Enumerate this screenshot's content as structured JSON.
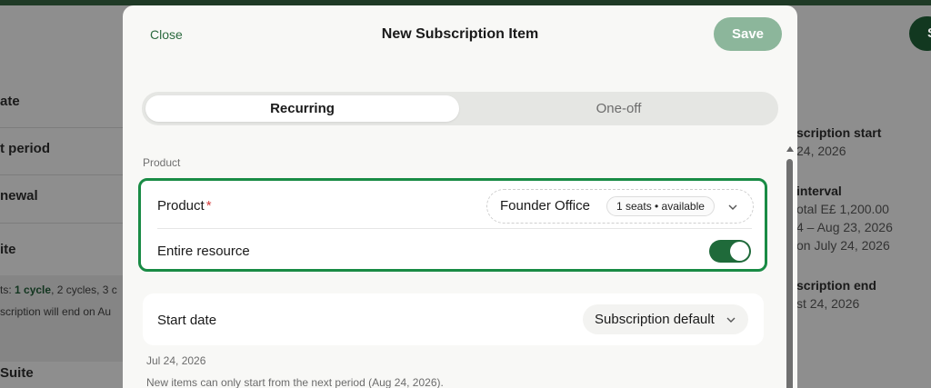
{
  "background": {
    "left_rows": [
      "ate",
      "t period",
      "newal",
      "ite"
    ],
    "left_cycles_prefix": "ts: ",
    "left_cycles_bold1": "1 cycle",
    "left_cycles_mid": ", 2 cycles, 3 c",
    "left_note": "scription will end on Au",
    "left_bottom": "Suite",
    "right_start_title": "scription start",
    "right_start_value": "24, 2026",
    "right_interval_title": "interval",
    "right_interval_line1": "otal E£ 1,200.00",
    "right_interval_line2": "4 – Aug 23, 2026",
    "right_interval_line3": "on July 24, 2026",
    "right_end_title": "scription end",
    "right_end_value": "st 24, 2026",
    "corner_button": "S"
  },
  "modal": {
    "close_label": "Close",
    "title": "New Subscription Item",
    "save_label": "Save",
    "tabs": [
      {
        "label": "Recurring",
        "active": true
      },
      {
        "label": "One-off",
        "active": false
      }
    ],
    "section_label": "Product",
    "product": {
      "label": "Product",
      "required_mark": "*",
      "selected_name": "Founder Office",
      "availability": "1 seats • available",
      "icon": "chevron-down-icon"
    },
    "entire_resource": {
      "label": "Entire resource",
      "enabled": true
    },
    "start_date": {
      "label": "Start date",
      "value": "Subscription default",
      "icon": "chevron-down-icon"
    },
    "date_text": "Jul 24, 2026",
    "hint_text": "New items can only start from the next period (Aug 24, 2026)."
  },
  "colors": {
    "accent": "#198b45",
    "save_button": "#8cb69b",
    "toggle_on": "#1f6a3a",
    "required": "#d33b3b"
  }
}
